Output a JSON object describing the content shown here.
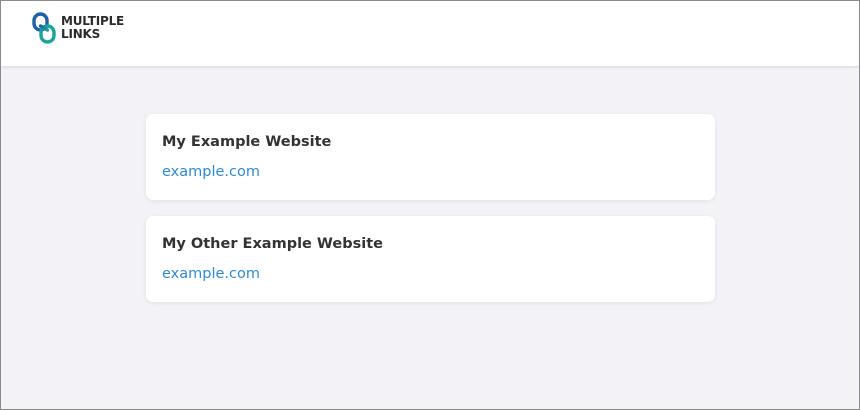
{
  "header": {
    "logo": {
      "line1": "MULTIPLE",
      "line2": "LINKS",
      "icon": "chain-link-icon",
      "colors": {
        "teal": "#1aa39a",
        "blue": "#1e5fa8"
      }
    }
  },
  "links": [
    {
      "title": "My Example Website",
      "url": "example.com"
    },
    {
      "title": "My Other Example Website",
      "url": "example.com"
    }
  ],
  "colors": {
    "background": "#f2f2f7",
    "card": "#ffffff",
    "link": "#2e8bd1",
    "title": "#333333"
  }
}
